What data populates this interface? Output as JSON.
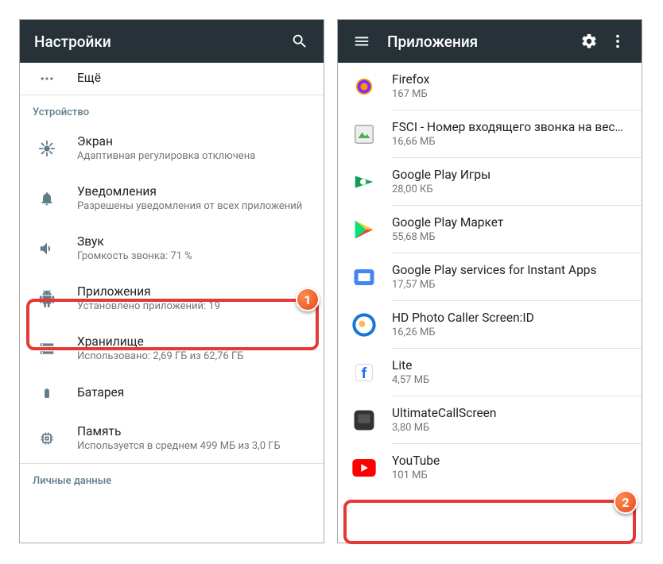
{
  "left": {
    "title": "Настройки",
    "more_label": "Ещё",
    "section_device": "Устройство",
    "section_personal": "Личные данные",
    "items": [
      {
        "label": "Экран",
        "sub": "Адаптивная регулировка отключена"
      },
      {
        "label": "Уведомления",
        "sub": "Разрешены уведомления от всех приложений"
      },
      {
        "label": "Звук",
        "sub": "Громкость звонка: 71 %"
      },
      {
        "label": "Приложения",
        "sub": "Установлено приложений: 19"
      },
      {
        "label": "Хранилище",
        "sub": "Использовано: 2,69 ГБ из 62,76 ГБ"
      },
      {
        "label": "Батарея",
        "sub": ""
      },
      {
        "label": "Память",
        "sub": "Используется в среднем 499 МБ из 3,0 ГБ"
      }
    ]
  },
  "right": {
    "title": "Приложения",
    "apps": [
      {
        "name": "Firefox",
        "size": "167 МБ"
      },
      {
        "name": "FSCI - Номер входящего звонка на весь э..",
        "size": "16,66 МБ"
      },
      {
        "name": "Google Play Игры",
        "size": "28,00 КБ"
      },
      {
        "name": "Google Play Маркет",
        "size": "55,68 МБ"
      },
      {
        "name": "Google Play services for Instant Apps",
        "size": "17,57 МБ"
      },
      {
        "name": "HD Photo Caller Screen:ID",
        "size": "16,26 МБ"
      },
      {
        "name": "Lite",
        "size": "4,57 МБ"
      },
      {
        "name": "UltimateCallScreen",
        "size": "3,80 МБ"
      },
      {
        "name": "YouTube",
        "size": "101 МБ"
      }
    ]
  },
  "callouts": {
    "one": "1",
    "two": "2"
  }
}
